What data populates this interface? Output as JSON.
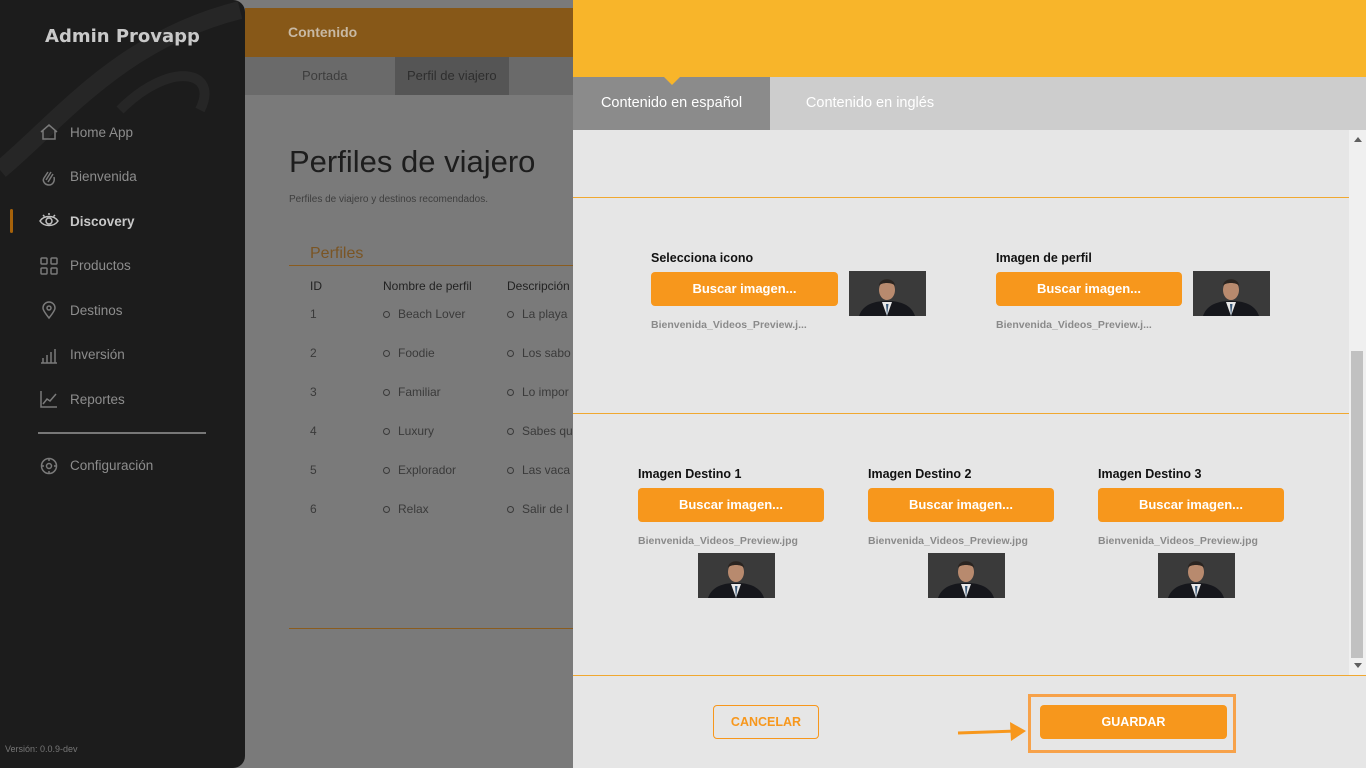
{
  "sidebar": {
    "brand": "Admin Provapp",
    "items": [
      {
        "label": "Home App",
        "icon": "home-icon"
      },
      {
        "label": "Bienvenida",
        "icon": "wave-hand-icon"
      },
      {
        "label": "Discovery",
        "icon": "eye-icon",
        "active": true
      },
      {
        "label": "Productos",
        "icon": "grid-icon"
      },
      {
        "label": "Destinos",
        "icon": "map-pin-icon"
      },
      {
        "label": "Inversión",
        "icon": "bar-chart-icon"
      },
      {
        "label": "Reportes",
        "icon": "line-chart-icon"
      }
    ],
    "settings_label": "Configuración",
    "version": "Versión: 0.0.9-dev"
  },
  "header": {
    "section_title": "Contenido",
    "tabs": [
      "Portada",
      "Perfil de viajero"
    ]
  },
  "main": {
    "title": "Perfiles de viajero",
    "subtitle": "Perfiles de viajero y destinos recomendados.",
    "section_heading": "Perfiles",
    "columns": [
      "ID",
      "Nombre de perfil",
      "Descripción"
    ],
    "rows": [
      {
        "id": "1",
        "name": "Beach Lover",
        "desc": "La playa"
      },
      {
        "id": "2",
        "name": "Foodie",
        "desc": "Los sabo"
      },
      {
        "id": "3",
        "name": "Familiar",
        "desc": "Lo impor"
      },
      {
        "id": "4",
        "name": "Luxury",
        "desc": "Sabes qu"
      },
      {
        "id": "5",
        "name": "Explorador",
        "desc": "Las vaca"
      },
      {
        "id": "6",
        "name": "Relax",
        "desc": "Salir de l"
      }
    ]
  },
  "panel": {
    "tabs": [
      "Contenido en español",
      "Contenido en inglés"
    ],
    "icon_field": {
      "label": "Selecciona icono",
      "button": "Buscar imagen...",
      "filename": "Bienvenida_Videos_Preview.j..."
    },
    "profile_field": {
      "label": "Imagen de perfil",
      "button": "Buscar imagen...",
      "filename": "Bienvenida_Videos_Preview.j..."
    },
    "destinations": [
      {
        "label": "Imagen Destino 1",
        "button": "Buscar imagen...",
        "filename": "Bienvenida_Videos_Preview.jpg"
      },
      {
        "label": "Imagen Destino 2",
        "button": "Buscar imagen...",
        "filename": "Bienvenida_Videos_Preview.jpg"
      },
      {
        "label": "Imagen Destino 3",
        "button": "Buscar imagen...",
        "filename": "Bienvenida_Videos_Preview.jpg"
      }
    ],
    "cancel_label": "CANCELAR",
    "save_label": "GUARDAR"
  },
  "colors": {
    "accent": "#f7971c",
    "panel_header": "#f8b52a",
    "sidebar_bg": "#1c1c1c"
  }
}
